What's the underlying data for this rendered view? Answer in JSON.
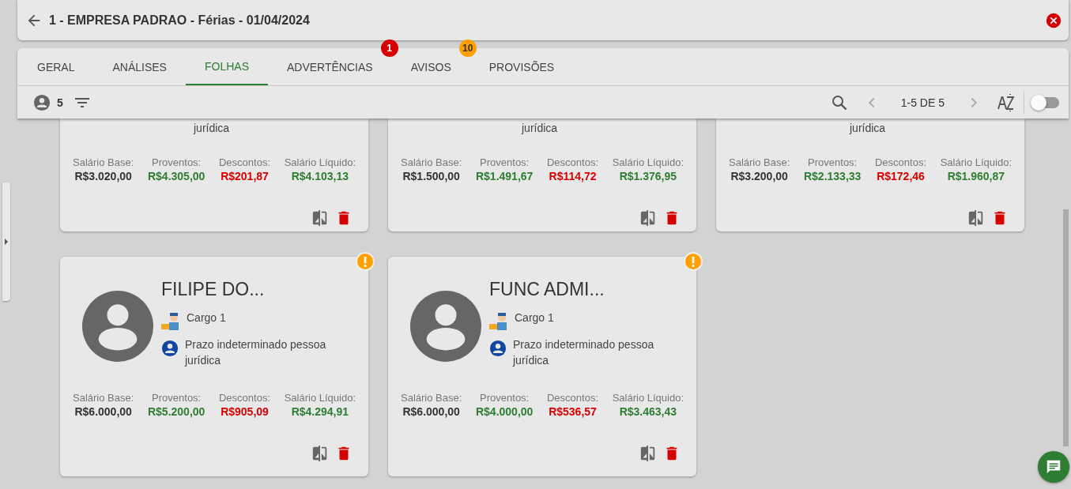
{
  "header": {
    "title": "1 - EMPRESA PADRAO - Férias - 01/04/2024"
  },
  "tabs": [
    {
      "label": "GERAL",
      "selected": false
    },
    {
      "label": "ANÁLISES",
      "selected": false
    },
    {
      "label": "FOLHAS",
      "selected": true
    },
    {
      "label": "ADVERTÊNCIAS",
      "selected": false,
      "badge": {
        "text": "1",
        "color": "#d50000"
      }
    },
    {
      "label": "AVISOS",
      "selected": false,
      "badge": {
        "text": "10",
        "color": "#ffa000"
      }
    },
    {
      "label": "PROVISÕES",
      "selected": false
    }
  ],
  "toolbar": {
    "count": "5",
    "pagination": "1-5 DE 5",
    "toggle_on": false
  },
  "cards": [
    {
      "kind": "partial",
      "contract": "jurídica",
      "warning": false,
      "salaries": [
        {
          "label": "Salário Base:",
          "value": "R$3.020,00",
          "kind": "base"
        },
        {
          "label": "Proventos:",
          "value": "R$4.305,00",
          "kind": "earning"
        },
        {
          "label": "Descontos:",
          "value": "R$201,87",
          "kind": "deduction"
        },
        {
          "label": "Salário Líquido:",
          "value": "R$4.103,13",
          "kind": "net"
        }
      ]
    },
    {
      "kind": "partial",
      "contract": "jurídica",
      "warning": false,
      "salaries": [
        {
          "label": "Salário Base:",
          "value": "R$1.500,00",
          "kind": "base"
        },
        {
          "label": "Proventos:",
          "value": "R$1.491,67",
          "kind": "earning"
        },
        {
          "label": "Descontos:",
          "value": "R$114,72",
          "kind": "deduction"
        },
        {
          "label": "Salário Líquido:",
          "value": "R$1.376,95",
          "kind": "net"
        }
      ]
    },
    {
      "kind": "partial",
      "contract": "jurídica",
      "warning": false,
      "salaries": [
        {
          "label": "Salário Base:",
          "value": "R$3.200,00",
          "kind": "base"
        },
        {
          "label": "Proventos:",
          "value": "R$2.133,33",
          "kind": "earning"
        },
        {
          "label": "Descontos:",
          "value": "R$172,46",
          "kind": "deduction"
        },
        {
          "label": "Salário Líquido:",
          "value": "R$1.960,87",
          "kind": "net"
        }
      ]
    },
    {
      "kind": "full",
      "name": "FILIPE DO...",
      "role": "Cargo 1",
      "contract": "Prazo indeterminado pessoa jurídica",
      "warning": true,
      "salaries": [
        {
          "label": "Salário Base:",
          "value": "R$6.000,00",
          "kind": "base"
        },
        {
          "label": "Proventos:",
          "value": "R$5.200,00",
          "kind": "earning"
        },
        {
          "label": "Descontos:",
          "value": "R$905,09",
          "kind": "deduction"
        },
        {
          "label": "Salário Líquido:",
          "value": "R$4.294,91",
          "kind": "net"
        }
      ]
    },
    {
      "kind": "full",
      "name": "FUNC ADMI...",
      "role": "Cargo 1",
      "contract": "Prazo indeterminado pessoa jurídica",
      "warning": true,
      "salaries": [
        {
          "label": "Salário Base:",
          "value": "R$6.000,00",
          "kind": "base"
        },
        {
          "label": "Proventos:",
          "value": "R$4.000,00",
          "kind": "earning"
        },
        {
          "label": "Descontos:",
          "value": "R$536,57",
          "kind": "deduction"
        },
        {
          "label": "Salário Líquido:",
          "value": "R$3.463,43",
          "kind": "net"
        }
      ]
    }
  ]
}
